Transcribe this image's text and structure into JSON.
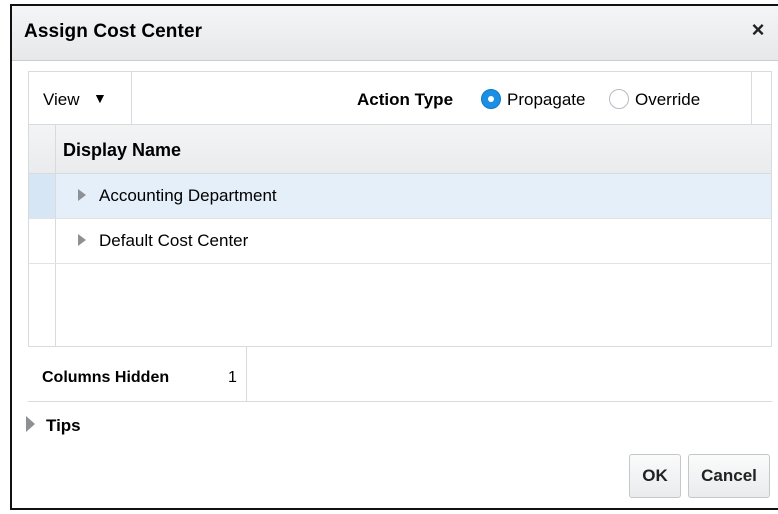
{
  "dialog": {
    "title": "Assign Cost Center",
    "close_glyph": "×"
  },
  "toolbar": {
    "view_label": "View",
    "view_caret": "▼",
    "action_type_label": "Action Type",
    "options": [
      {
        "label": "Propagate",
        "selected": true
      },
      {
        "label": "Override",
        "selected": false
      }
    ]
  },
  "table": {
    "column_header": "Display Name",
    "rows": [
      {
        "label": "Accounting Department",
        "selected": true
      },
      {
        "label": "Default Cost Center",
        "selected": false
      }
    ]
  },
  "status": {
    "columns_hidden_label": "Columns Hidden",
    "columns_hidden_value": "1"
  },
  "tips": {
    "label": "Tips"
  },
  "buttons": {
    "ok": "OK",
    "cancel": "Cancel"
  },
  "colors": {
    "accent": "#1a8fe3",
    "selected_row": "#e4eff9"
  }
}
